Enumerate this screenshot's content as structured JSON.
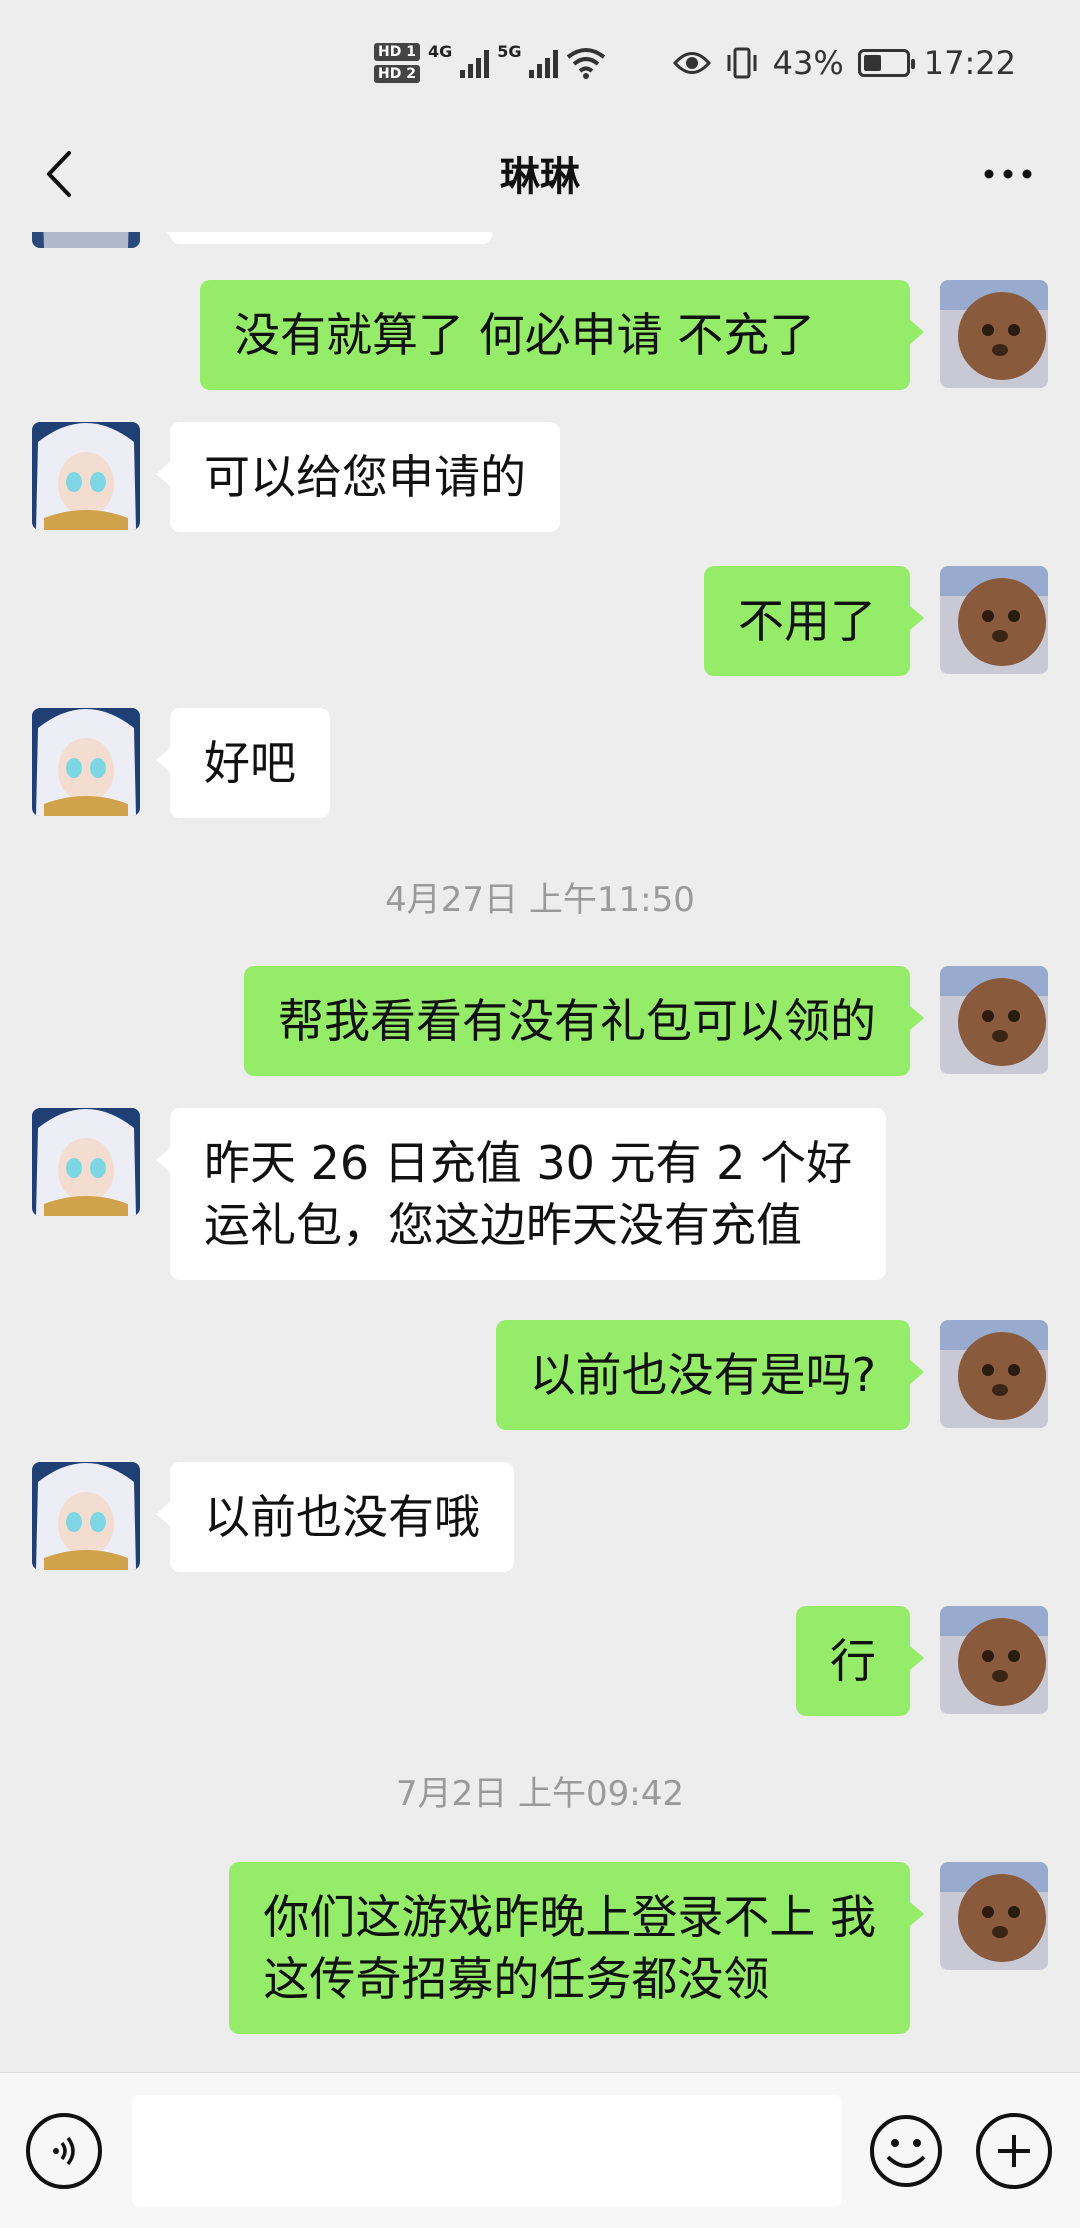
{
  "status_bar": {
    "net1": "4G",
    "net2": "5G",
    "hd1": "HD 1",
    "hd2": "HD 2",
    "battery_percent": "43%",
    "battery_level": 0.43,
    "time": "17:22"
  },
  "header": {
    "title": "琳琳"
  },
  "messages": [
    {
      "side": "out",
      "text": "没有就算了 何必申请 不充了"
    },
    {
      "side": "in",
      "text": "可以给您申请的"
    },
    {
      "side": "out",
      "text": "不用了"
    },
    {
      "side": "in",
      "text": "好吧"
    },
    {
      "side": "out",
      "text": "帮我看看有没有礼包可以领的"
    },
    {
      "side": "in",
      "text_line1": "昨天 26 日充值 30 元有 2 个好",
      "text_line2": "运礼包，您这边昨天没有充值"
    },
    {
      "side": "out",
      "text": "以前也没有是吗?"
    },
    {
      "side": "in",
      "text": "以前也没有哦"
    },
    {
      "side": "out",
      "text": "行"
    },
    {
      "side": "out",
      "text_line1": "你们这游戏昨晚上登录不上 我",
      "text_line2": "这传奇招募的任务都没领"
    }
  ],
  "timestamps": [
    "4月27日 上午11:50",
    "7月2日 上午09:42"
  ],
  "input_bar": {
    "text_value": ""
  }
}
